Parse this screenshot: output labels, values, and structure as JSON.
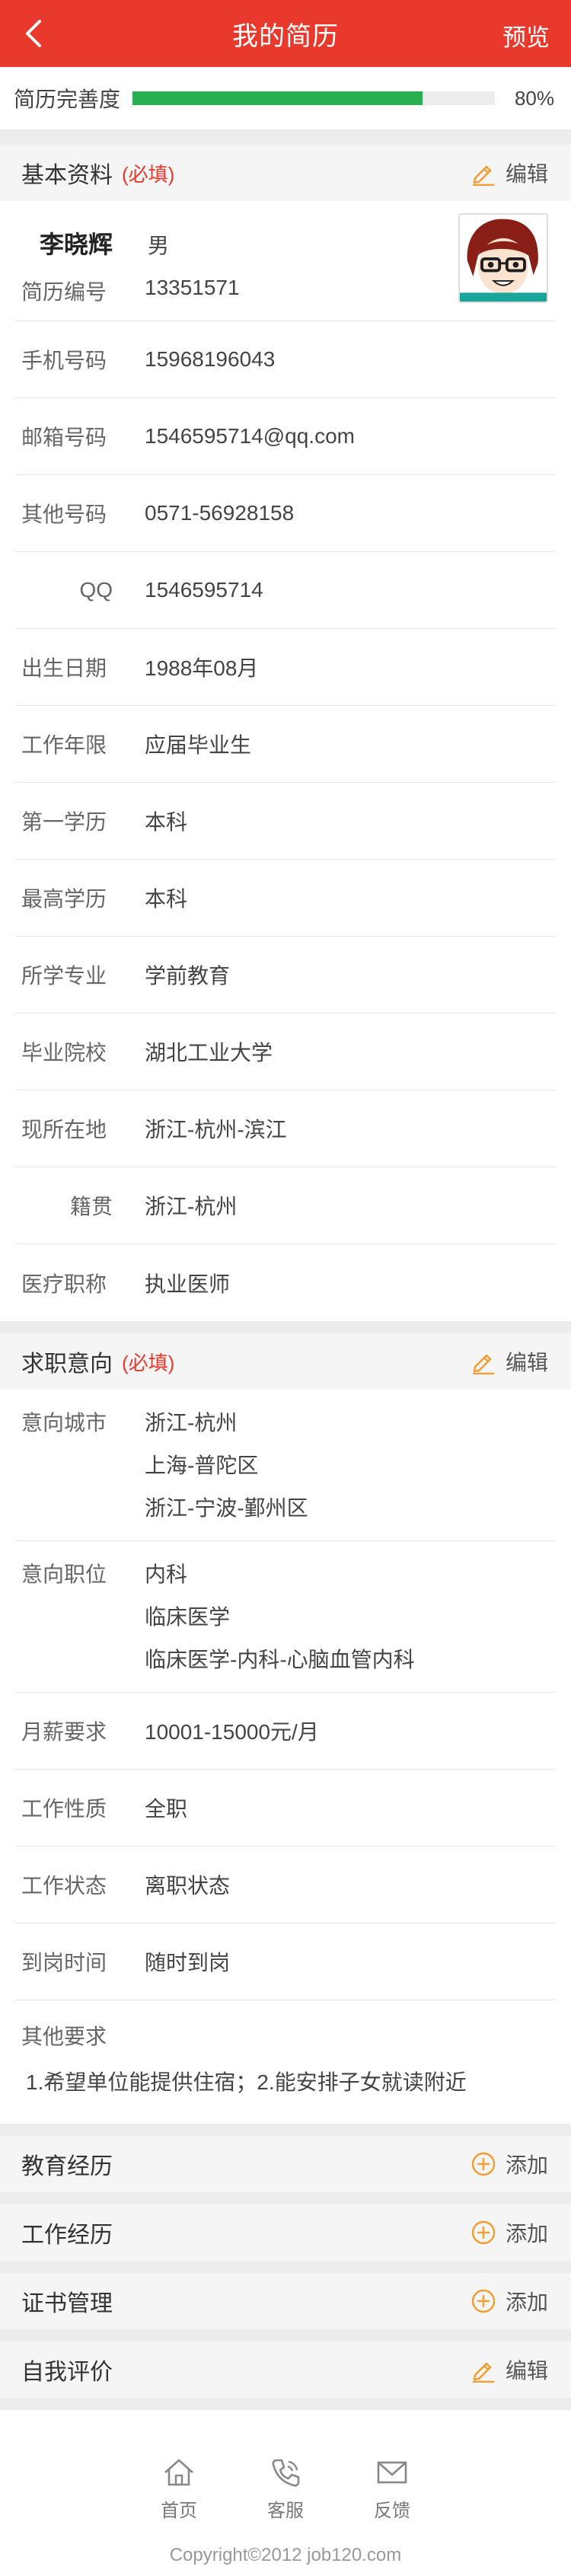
{
  "header": {
    "title": "我的简历",
    "preview": "预览"
  },
  "completeness": {
    "label": "简历完善度",
    "percent_text": "80%",
    "percent": 0.8
  },
  "basic": {
    "title": "基本资料",
    "required": "(必填)",
    "edit": "编辑",
    "name": "李晓辉",
    "gender": "男",
    "id_label": "简历编号",
    "id_value": "13351571",
    "fields": [
      {
        "label": "手机号码",
        "value": "15968196043"
      },
      {
        "label": "邮箱号码",
        "value": "1546595714@qq.com"
      },
      {
        "label": "其他号码",
        "value": "0571-56928158"
      },
      {
        "label": "QQ",
        "value": "1546595714"
      },
      {
        "label": "出生日期",
        "value": "1988年08月"
      },
      {
        "label": "工作年限",
        "value": "应届毕业生"
      },
      {
        "label": "第一学历",
        "value": "本科"
      },
      {
        "label": "最高学历",
        "value": "本科"
      },
      {
        "label": "所学专业",
        "value": "学前教育"
      },
      {
        "label": "毕业院校",
        "value": "湖北工业大学"
      },
      {
        "label": "现所在地",
        "value": "浙江-杭州-滨江"
      },
      {
        "label": "籍贯",
        "value": "浙江-杭州"
      },
      {
        "label": "医疗职称",
        "value": "执业医师"
      }
    ]
  },
  "intent": {
    "title": "求职意向",
    "required": "(必填)",
    "edit": "编辑",
    "city_label": "意向城市",
    "cities": [
      "浙江-杭州",
      "上海-普陀区",
      "浙江-宁波-鄞州区"
    ],
    "position_label": "意向职位",
    "positions": [
      "内科",
      "临床医学",
      "临床医学-内科-心脑血管内科"
    ],
    "fields": [
      {
        "label": "月薪要求",
        "value": "10001-15000元/月"
      },
      {
        "label": "工作性质",
        "value": "全职"
      },
      {
        "label": "工作状态",
        "value": "离职状态"
      },
      {
        "label": "到岗时间",
        "value": "随时到岗"
      }
    ],
    "other_label": "其他要求",
    "other_value": "1.希望单位能提供住宿；2.能安排子女就读附近"
  },
  "sections": {
    "education": {
      "title": "教育经历",
      "action": "添加"
    },
    "work": {
      "title": "工作经历",
      "action": "添加"
    },
    "certificate": {
      "title": "证书管理",
      "action": "添加"
    },
    "self_eval": {
      "title": "自我评价",
      "action": "编辑"
    }
  },
  "footer": {
    "nav": {
      "home": "首页",
      "service": "客服",
      "feedback": "反馈"
    },
    "copyright": "Copyright©2012  job120.com"
  },
  "colors": {
    "brand": "#e8392c",
    "progress": "#2aae52",
    "icon_orange": "#f39c2f"
  }
}
